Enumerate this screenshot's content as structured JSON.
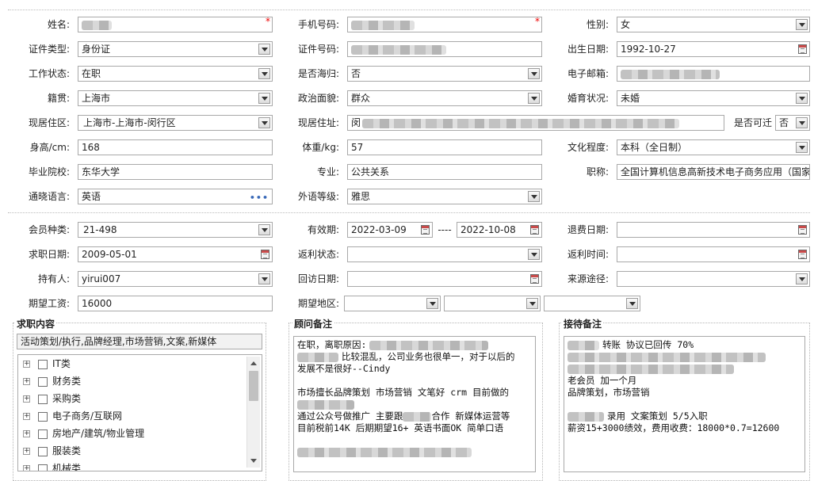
{
  "basic": {
    "name_label": "姓名:",
    "mobile_label": "手机号码:",
    "gender_label": "性别:",
    "gender_value": "女",
    "id_type_label": "证件类型:",
    "id_type_value": "身份证",
    "id_number_label": "证件号码:",
    "birth_label": "出生日期:",
    "birth_value": "1992-10-27",
    "work_status_label": "工作状态:",
    "work_status_value": "在职",
    "overseas_label": "是否海归:",
    "overseas_value": "否",
    "email_label": "电子邮箱:",
    "native_label": "籍贯:",
    "native_value": "上海市",
    "political_label": "政治面貌:",
    "political_value": "群众",
    "marital_label": "婚育状况:",
    "marital_value": "未婚",
    "residence_label": "现居住区:",
    "residence_value": "上海市-上海市-闵行区",
    "address_label": "现居住址:",
    "address_prefix": "闵",
    "movable_label": "是否可迁",
    "movable_value": "否",
    "height_label": "身高/cm:",
    "height_value": "168",
    "weight_label": "体重/kg:",
    "weight_value": "57",
    "education_label": "文化程度:",
    "education_value": "本科（全日制）",
    "school_label": "毕业院校:",
    "school_value": "东华大学",
    "major_label": "专业:",
    "major_value": "公共关系",
    "title_label": "职称:",
    "title_value": "全国计算机信息高新技术电子商务应用（国家",
    "language_label": "通晓语言:",
    "language_value": "英语",
    "language_more": "•••",
    "foreign_label": "外语等级:",
    "foreign_value": "雅思"
  },
  "member": {
    "type_label": "会员种类:",
    "type_value": "21-498",
    "validity_label": "有效期:",
    "valid_from": "2022-03-09",
    "valid_sep": "----",
    "valid_to": "2022-10-08",
    "refund_label": "退费日期:",
    "job_date_label": "求职日期:",
    "job_date_value": "2009-05-01",
    "rebate_status_label": "返利状态:",
    "rebate_time_label": "返利时间:",
    "holder_label": "持有人:",
    "holder_value": "yirui007",
    "visit_label": "回访日期:",
    "source_label": "来源途径:",
    "salary_label": "期望工资:",
    "salary_value": "16000",
    "region_label": "期望地区:"
  },
  "job": {
    "title": "求职内容",
    "summary": "活动策划/执行,品牌经理,市场营销,文案,新媒体",
    "categories": [
      "IT类",
      "财务类",
      "采购类",
      "电子商务/互联网",
      "房地产/建筑/物业管理",
      "服装类",
      "机械类"
    ],
    "expand_glyph": "+"
  },
  "consultant": {
    "title": "顾问备注",
    "lines": [
      "在职，离职原因:",
      "比较混乱，公司业务也很单一，对于以后的",
      "发展不是很好--Cindy",
      "",
      "市场擅长品牌策划 市场营销 文笔好  crm  目前做的",
      "",
      "通过公众号做推广 主要跟",
      "合作  新媒体运营等",
      "目前税前14K  后期期望16+   英语书面OK 简单口语"
    ]
  },
  "reception": {
    "title": "接待备注",
    "lines": [
      "转账 协议已回传 70%",
      "老会员 加一个月",
      "品牌策划，市场营销",
      "录用  文案策划  5/5入职",
      "薪资15+3000绩效，费用收费：18000*0.7=12600"
    ]
  }
}
